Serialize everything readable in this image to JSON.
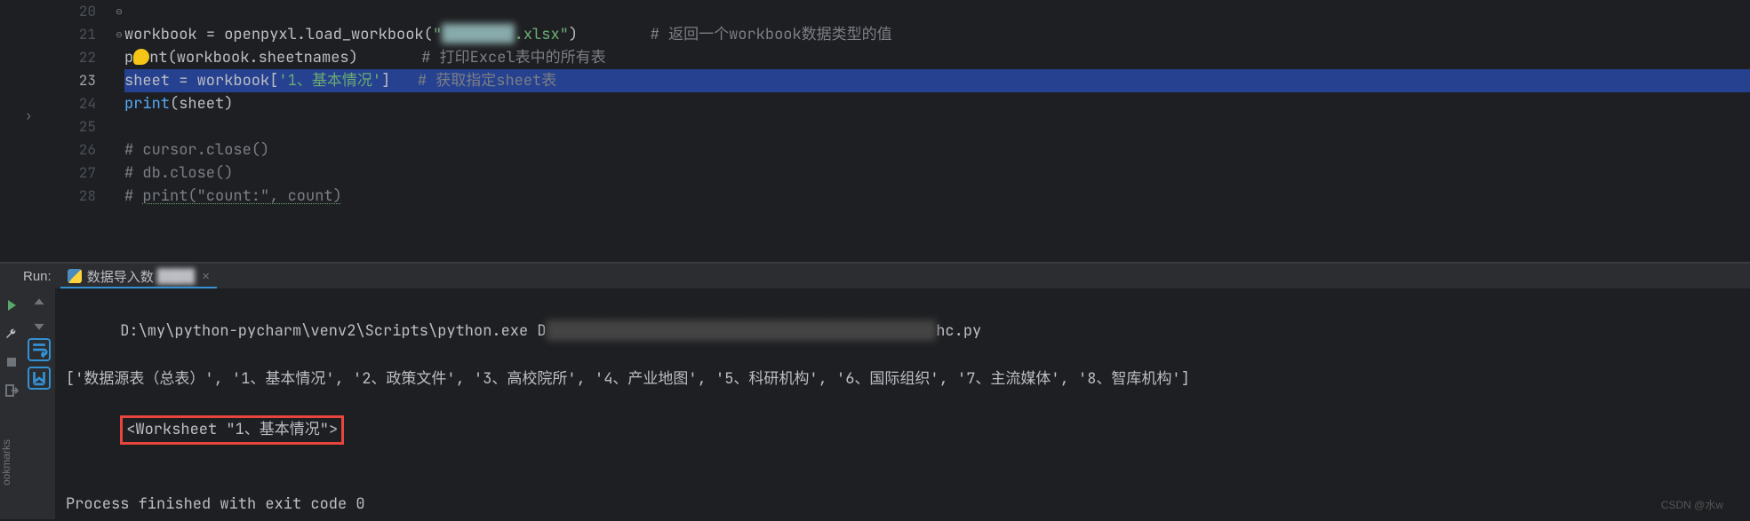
{
  "editor": {
    "lines": [
      {
        "num": 20,
        "html": ""
      },
      {
        "num": 21,
        "parts": [
          {
            "t": "workbook ",
            "c": "k-var"
          },
          {
            "t": "= ",
            "c": "k-op"
          },
          {
            "t": "openpyxl",
            "c": "k-var"
          },
          {
            "t": ".",
            "c": "k-op"
          },
          {
            "t": "load_workbook",
            "c": "k-call"
          },
          {
            "t": "(",
            "c": "k-op"
          },
          {
            "t": "\"",
            "c": "k-str"
          },
          {
            "t": "████████",
            "c": "k-blur"
          },
          {
            "t": ".xlsx\"",
            "c": "k-str"
          },
          {
            "t": ")        ",
            "c": "k-op"
          },
          {
            "t": "# 返回一个workbook数据类型的值",
            "c": "k-cmt"
          }
        ]
      },
      {
        "num": 22,
        "parts": [
          {
            "t": "p",
            "c": "k-var"
          },
          {
            "bulb": true
          },
          {
            "t": "nt",
            "c": "k-var"
          },
          {
            "t": "(workbook.sheetnames)       ",
            "c": "k-var"
          },
          {
            "t": "# 打印Excel表中的所有表",
            "c": "k-cmt"
          }
        ]
      },
      {
        "num": 23,
        "highlight": true,
        "parts": [
          {
            "t": "sheet ",
            "c": "k-var"
          },
          {
            "t": "= ",
            "c": "k-op"
          },
          {
            "t": "workbook",
            "c": "k-var"
          },
          {
            "t": "[",
            "c": "k-op"
          },
          {
            "t": "'1、基本情况'",
            "c": "k-str"
          },
          {
            "t": "]   ",
            "c": "k-op"
          },
          {
            "t": "# 获取指定sheet表",
            "c": "k-cmt"
          }
        ]
      },
      {
        "num": 24,
        "parts": [
          {
            "t": "print",
            "c": "k-fn"
          },
          {
            "t": "(sheet)",
            "c": "k-var"
          }
        ]
      },
      {
        "num": 25,
        "parts": []
      },
      {
        "num": 26,
        "fold": "⊖",
        "parts": [
          {
            "t": "# cursor.close()",
            "c": "k-cmt"
          }
        ]
      },
      {
        "num": 27,
        "parts": [
          {
            "t": "# db.close()",
            "c": "k-cmt"
          }
        ]
      },
      {
        "num": 28,
        "fold": "⊖",
        "parts": [
          {
            "t": "# ",
            "c": "k-cmt"
          },
          {
            "t": "print(\"count:\", count)",
            "c": "k-cmt str-u"
          }
        ]
      }
    ]
  },
  "sidebar": {
    "bookmarks_label": "ookmarks"
  },
  "run": {
    "label": "Run:",
    "tab_name": "数据导入数",
    "tab_blur": "████"
  },
  "console": {
    "line1_prefix": "D:\\my\\python-pycharm\\venv2\\Scripts\\python.exe D",
    "line1_blur": "███████████████████████████████████████████",
    "line1_suffix": "hc.py",
    "line2": "['数据源表（总表）', '1、基本情况', '2、政策文件', '3、高校院所', '4、产业地图', '5、科研机构', '6、国际组织', '7、主流媒体', '8、智库机构']",
    "line3": "<Worksheet \"1、基本情况\">",
    "line5": "Process finished with exit code 0"
  },
  "watermark": "CSDN @水w"
}
